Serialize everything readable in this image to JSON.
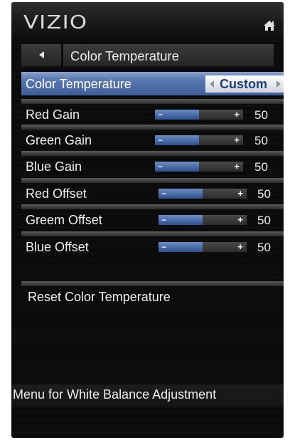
{
  "header": {
    "logo_text": "VIZIO",
    "home_icon": "home-icon"
  },
  "breadcrumb": {
    "back_icon": "back-arrow-icon",
    "title": "Color Temperature"
  },
  "selected_row": {
    "label": "Color Temperature",
    "value": "Custom"
  },
  "sliders": [
    {
      "label": "Red Gain",
      "value": "50",
      "level": 0.5
    },
    {
      "label": "Green Gain",
      "value": "50",
      "level": 0.5
    },
    {
      "label": "Blue Gain",
      "value": "50",
      "level": 0.5
    },
    {
      "label": "Red Offset",
      "value": "50",
      "level": 0.5
    },
    {
      "label": "Greem Offset",
      "value": "50",
      "level": 0.5
    },
    {
      "label": "Blue Offset",
      "value": "50",
      "level": 0.5
    }
  ],
  "reset": {
    "label": "Reset Color Temperature"
  },
  "description": "Menu for White Balance Adjustment",
  "slider_symbols": {
    "minus": "−",
    "plus": "+"
  },
  "colors": {
    "highlight": "#4a6aa6",
    "slider_fill": "#4f73b0",
    "value_text": "#1d3f7a"
  }
}
